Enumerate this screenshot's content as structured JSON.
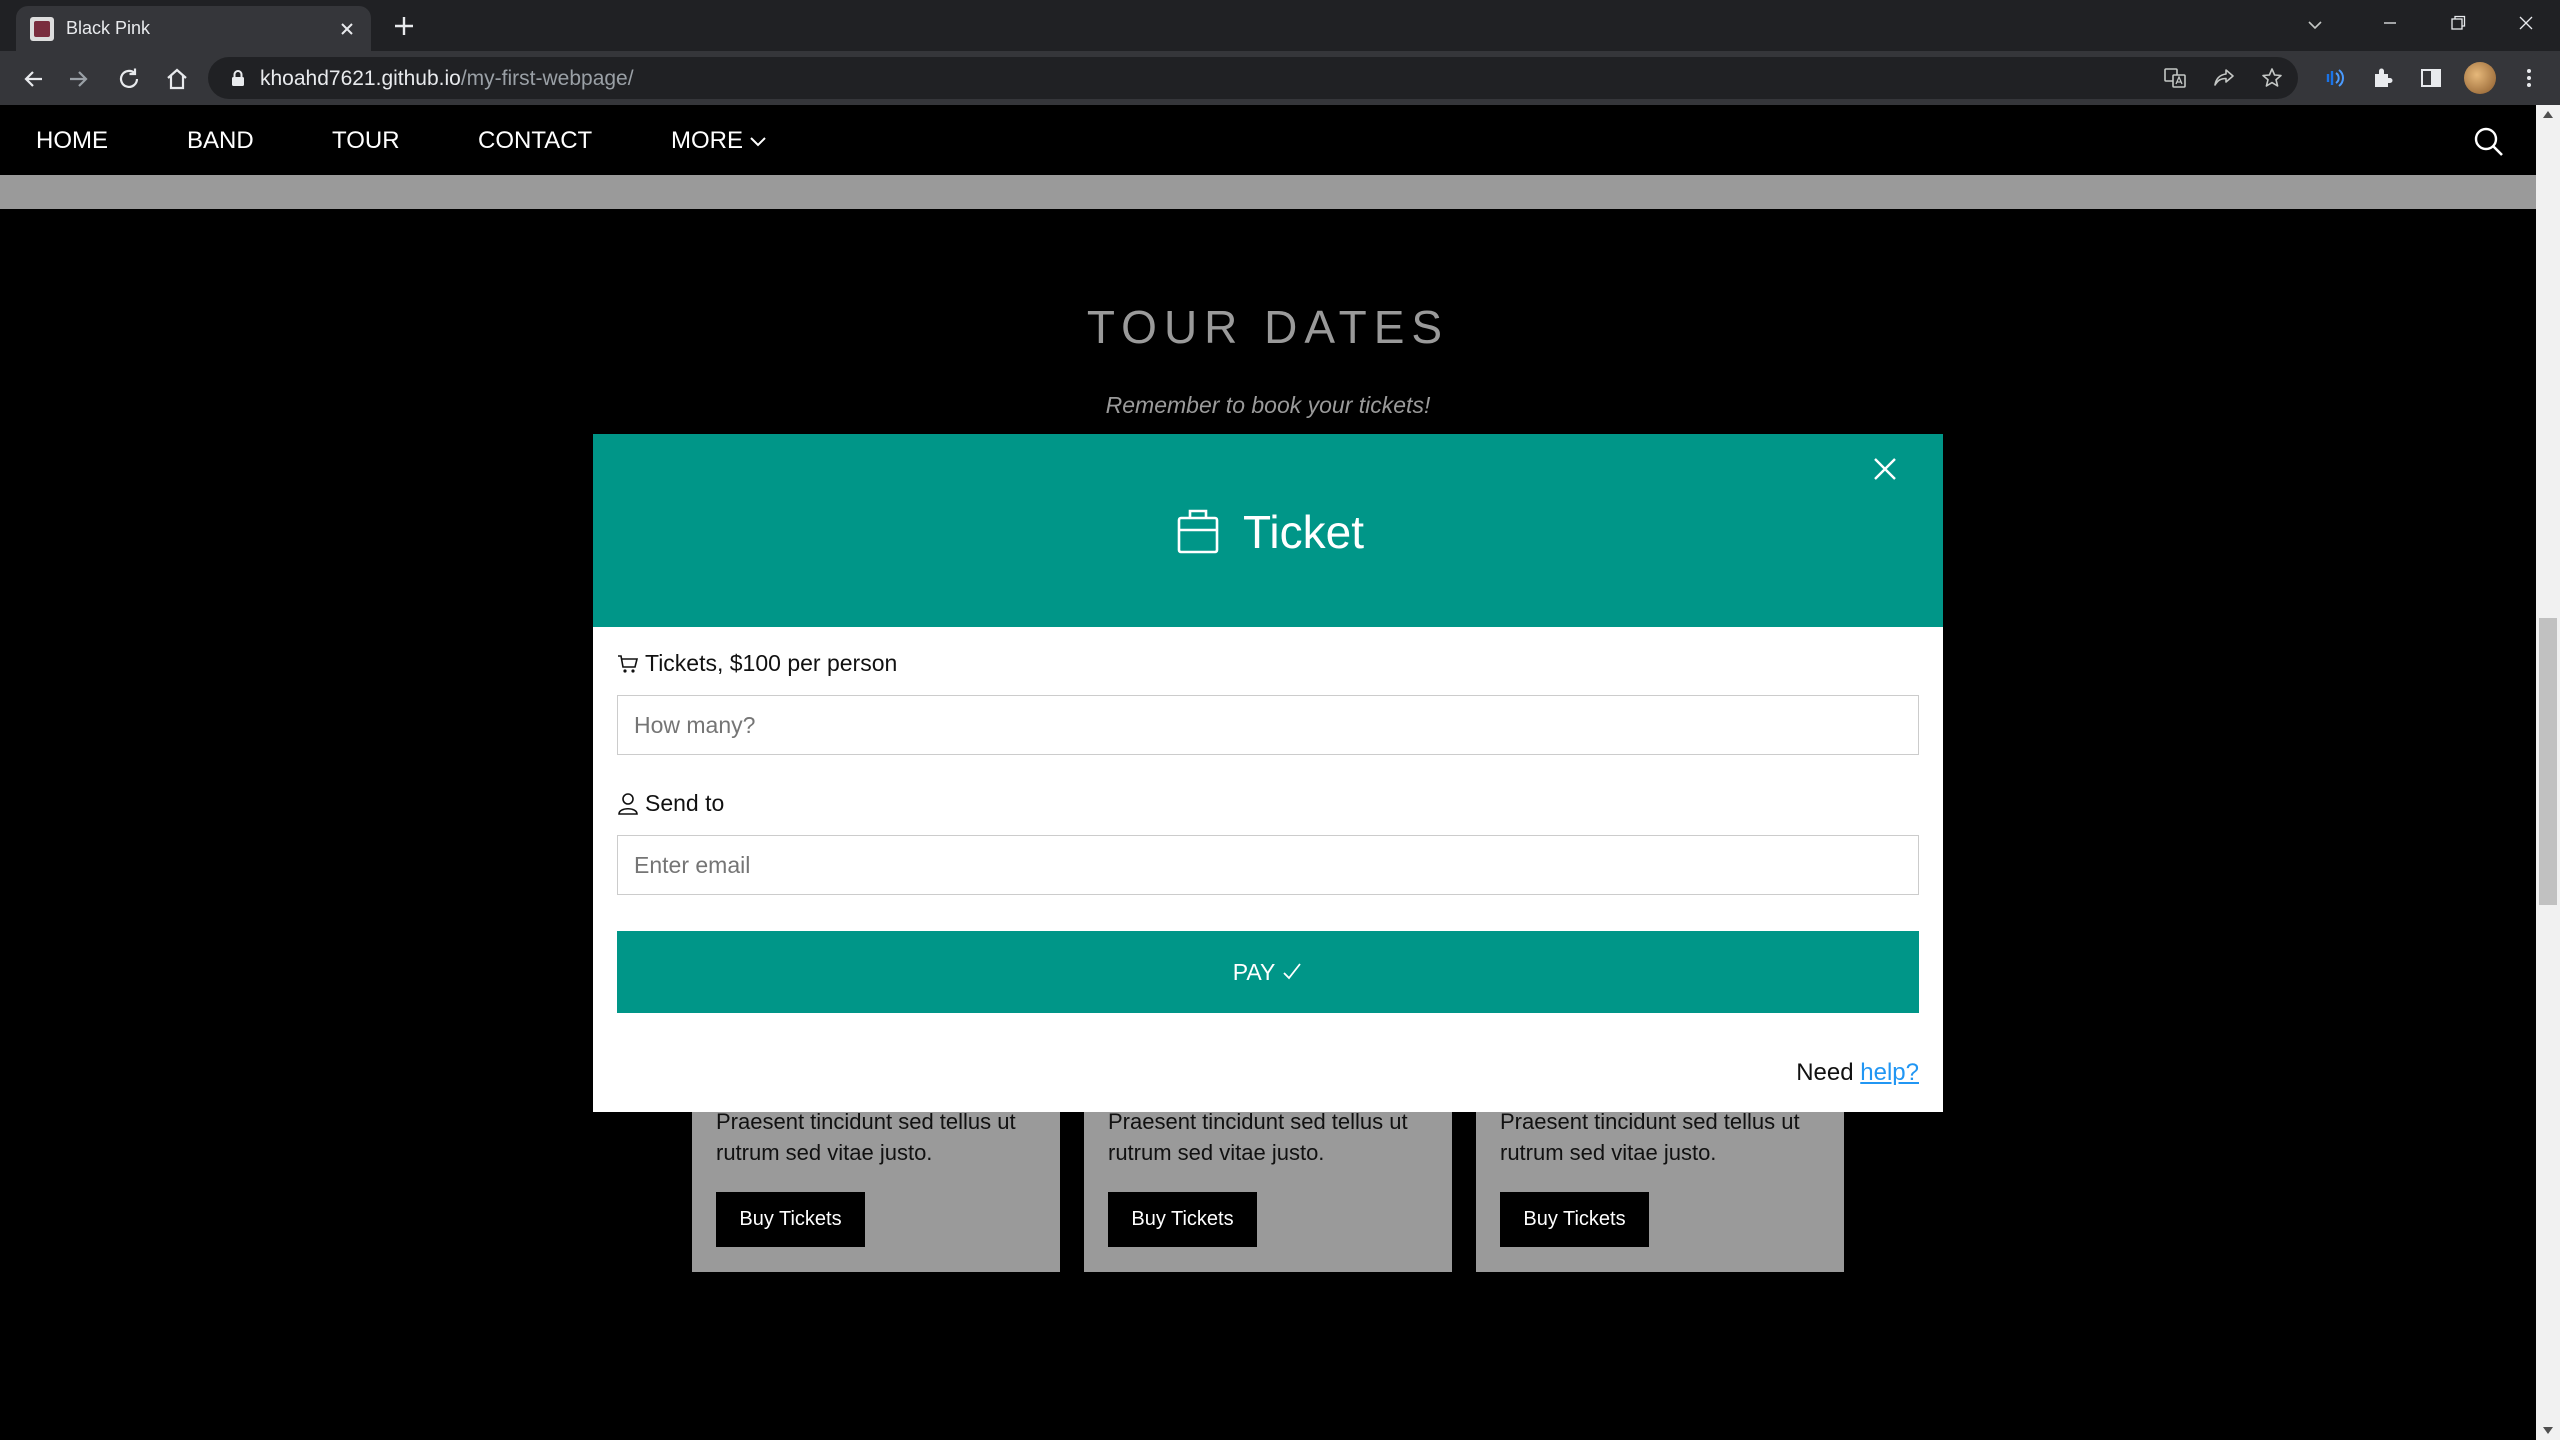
{
  "browser": {
    "tab_title": "Black Pink",
    "url_host": "khoahd7621.github.io",
    "url_path": "/my-first-webpage/"
  },
  "nav": {
    "items": [
      "HOME",
      "BAND",
      "TOUR",
      "CONTACT"
    ],
    "more_label": "MORE"
  },
  "page": {
    "title": "TOUR DATES",
    "subtitle": "Remember to book your tickets!",
    "cards": [
      {
        "text": "Praesent tincidunt sed tellus ut rutrum sed vitae justo.",
        "button": "Buy Tickets"
      },
      {
        "text": "Praesent tincidunt sed tellus ut rutrum sed vitae justo.",
        "button": "Buy Tickets"
      },
      {
        "text": "Praesent tincidunt sed tellus ut rutrum sed vitae justo.",
        "button": "Buy Tickets"
      }
    ]
  },
  "modal": {
    "title": "Ticket",
    "tickets_label": "Tickets, $100 per person",
    "tickets_placeholder": "How many?",
    "send_label": "Send to",
    "email_placeholder": "Enter email",
    "pay_label": "PAY",
    "help_prefix": "Need",
    "help_link": "help?"
  },
  "colors": {
    "accent": "#009688",
    "link": "#2196F3",
    "page_bg": "#000000",
    "muted_grey": "#9a9a9a"
  }
}
